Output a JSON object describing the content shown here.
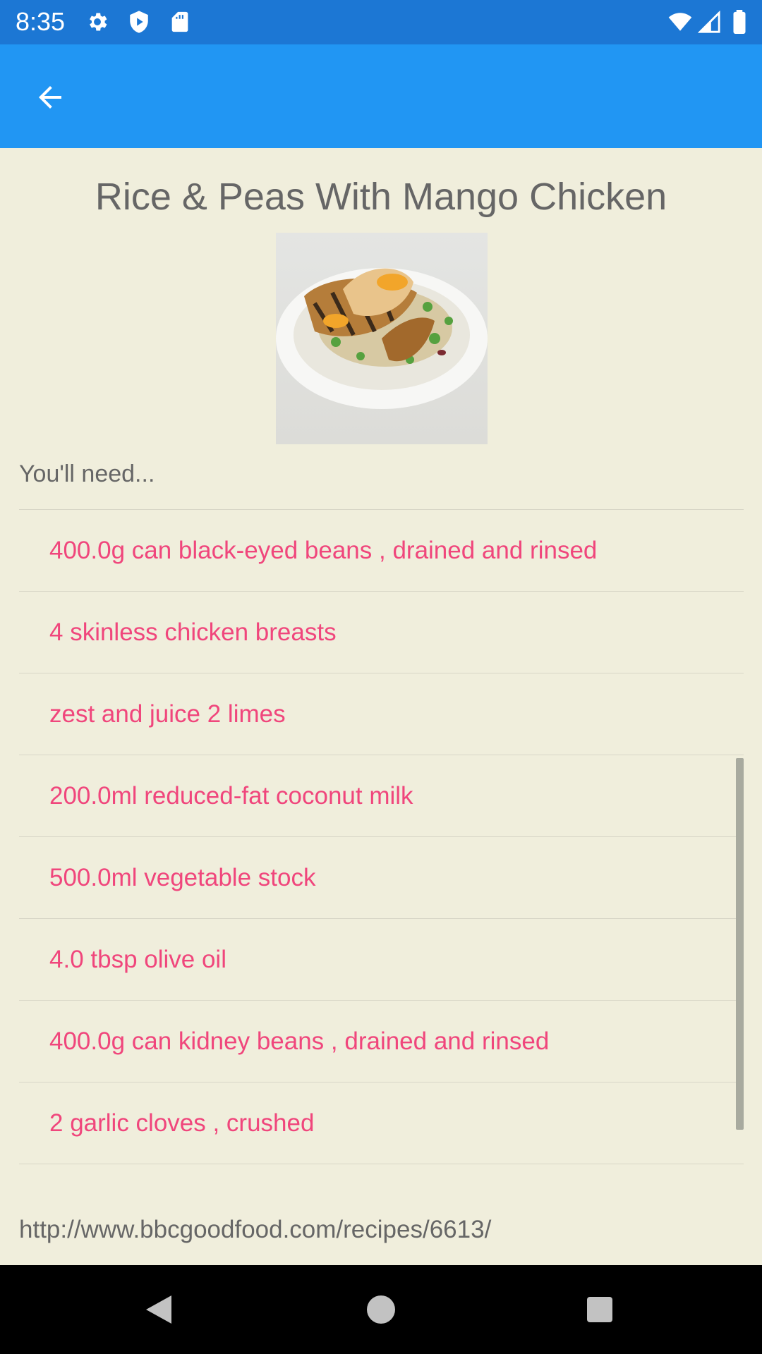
{
  "status_bar": {
    "time": "8:35",
    "icons": [
      "gear-icon",
      "shield-play-icon",
      "sd-card-icon",
      "wifi-icon",
      "cell-signal-icon",
      "battery-icon"
    ],
    "color": "#1c77d4"
  },
  "app_bar": {
    "back_icon": "arrow-left-icon",
    "color": "#2196f3"
  },
  "recipe": {
    "title": "Rice & Peas With Mango Chicken",
    "need_label": "You'll need...",
    "ingredients": [
      "400.0g can black-eyed beans , drained and rinsed",
      "4 skinless chicken breasts",
      "zest and juice 2 limes",
      "200.0ml reduced-fat coconut milk",
      "500.0ml vegetable stock",
      "4.0 tbsp olive oil",
      "400.0g can kidney beans , drained and rinsed",
      "2 garlic cloves , crushed"
    ],
    "source_url": "http://www.bbcgoodfood.com/recipes/6613/"
  },
  "colors": {
    "background": "#f0eedc",
    "ingredient_text": "#f0467c",
    "secondary_text": "#666666"
  },
  "nav_bar": {
    "buttons": [
      "back-triangle-icon",
      "home-circle-icon",
      "recents-square-icon"
    ]
  }
}
